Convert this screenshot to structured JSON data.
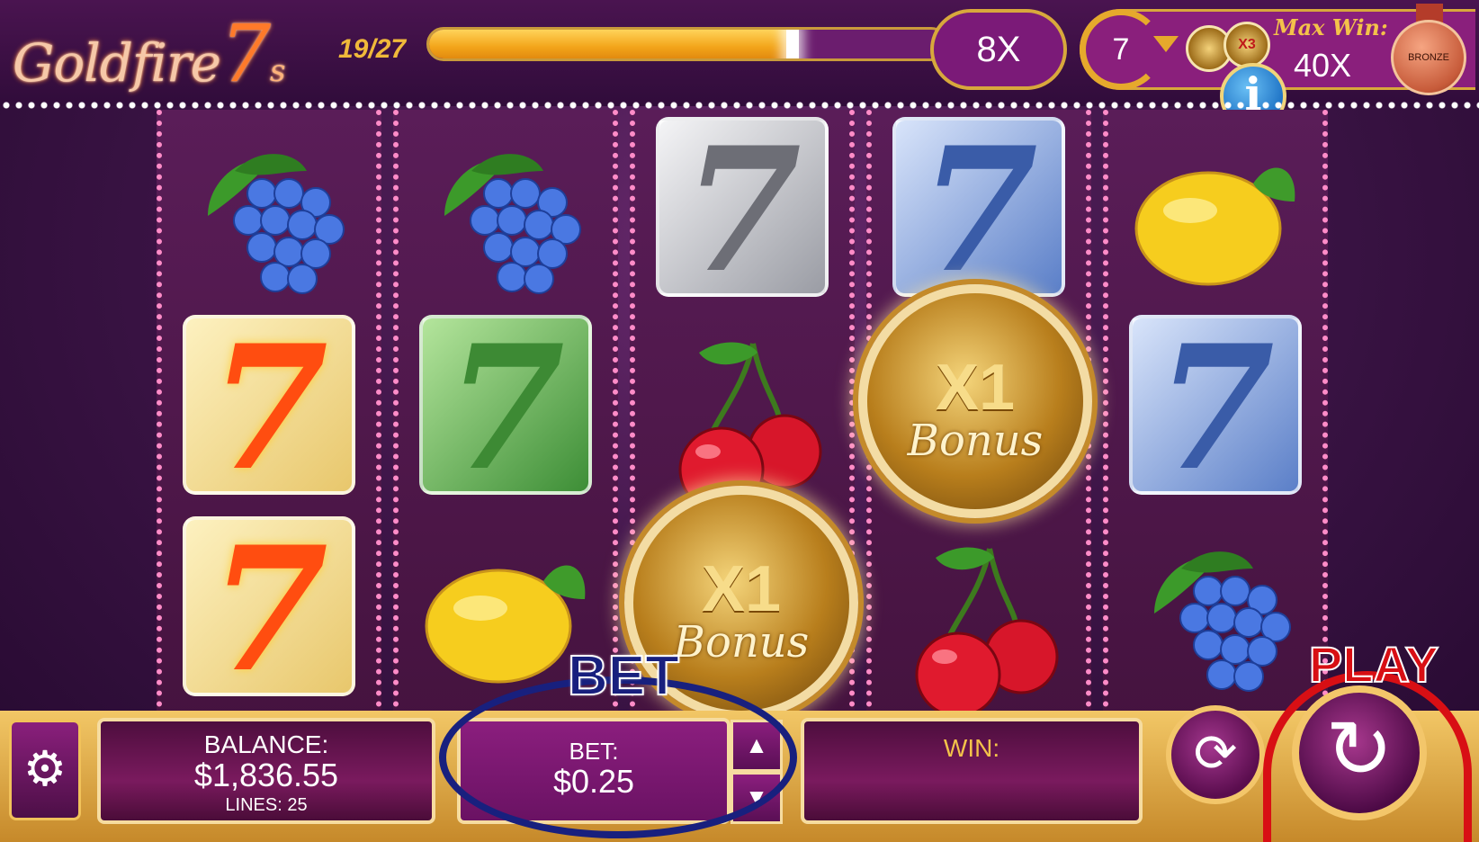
{
  "game": {
    "logo_main": "Goldfire",
    "logo_seven": "7",
    "logo_suffix": "s"
  },
  "header": {
    "progress_text": "19/27",
    "progress_fraction": 0.704,
    "multiplier": "8X",
    "free_spins": "7",
    "mini_coin_label": "X3",
    "max_win_label": "Max Win:",
    "max_win_value": "40X",
    "info_label": "i",
    "badge_label": "BRONZE"
  },
  "reels": [
    [
      "grapes",
      "seven-fire",
      "seven-fire"
    ],
    [
      "grapes",
      "seven-green",
      "lemon"
    ],
    [
      "seven-silver",
      "cherries",
      "bonus"
    ],
    [
      "seven-blue",
      "bonus",
      "cherries"
    ],
    [
      "lemon",
      "seven-blue",
      "grapes"
    ]
  ],
  "symbols": {
    "seven": "7",
    "bonus_mult": "X1",
    "bonus_word": "Bonus"
  },
  "bottom": {
    "settings_icon": "gear-icon",
    "balance_label": "BALANCE:",
    "balance_value": "$1,836.55",
    "lines_label": "LINES: 25",
    "bet_label": "BET:",
    "bet_value": "$0.25",
    "bet_up": "▲",
    "bet_down": "▼",
    "win_label": "WIN:",
    "autoplay_icon": "autoplay-icon",
    "spin_icon": "spin-icon"
  },
  "annotations": {
    "bet_callout": "BET",
    "play_callout": "PLAY"
  },
  "colors": {
    "accent_gold": "#f3c66a",
    "panel_purple": "#8b1e7e",
    "annotation_blue": "#18207e",
    "annotation_red": "#d80f14"
  }
}
